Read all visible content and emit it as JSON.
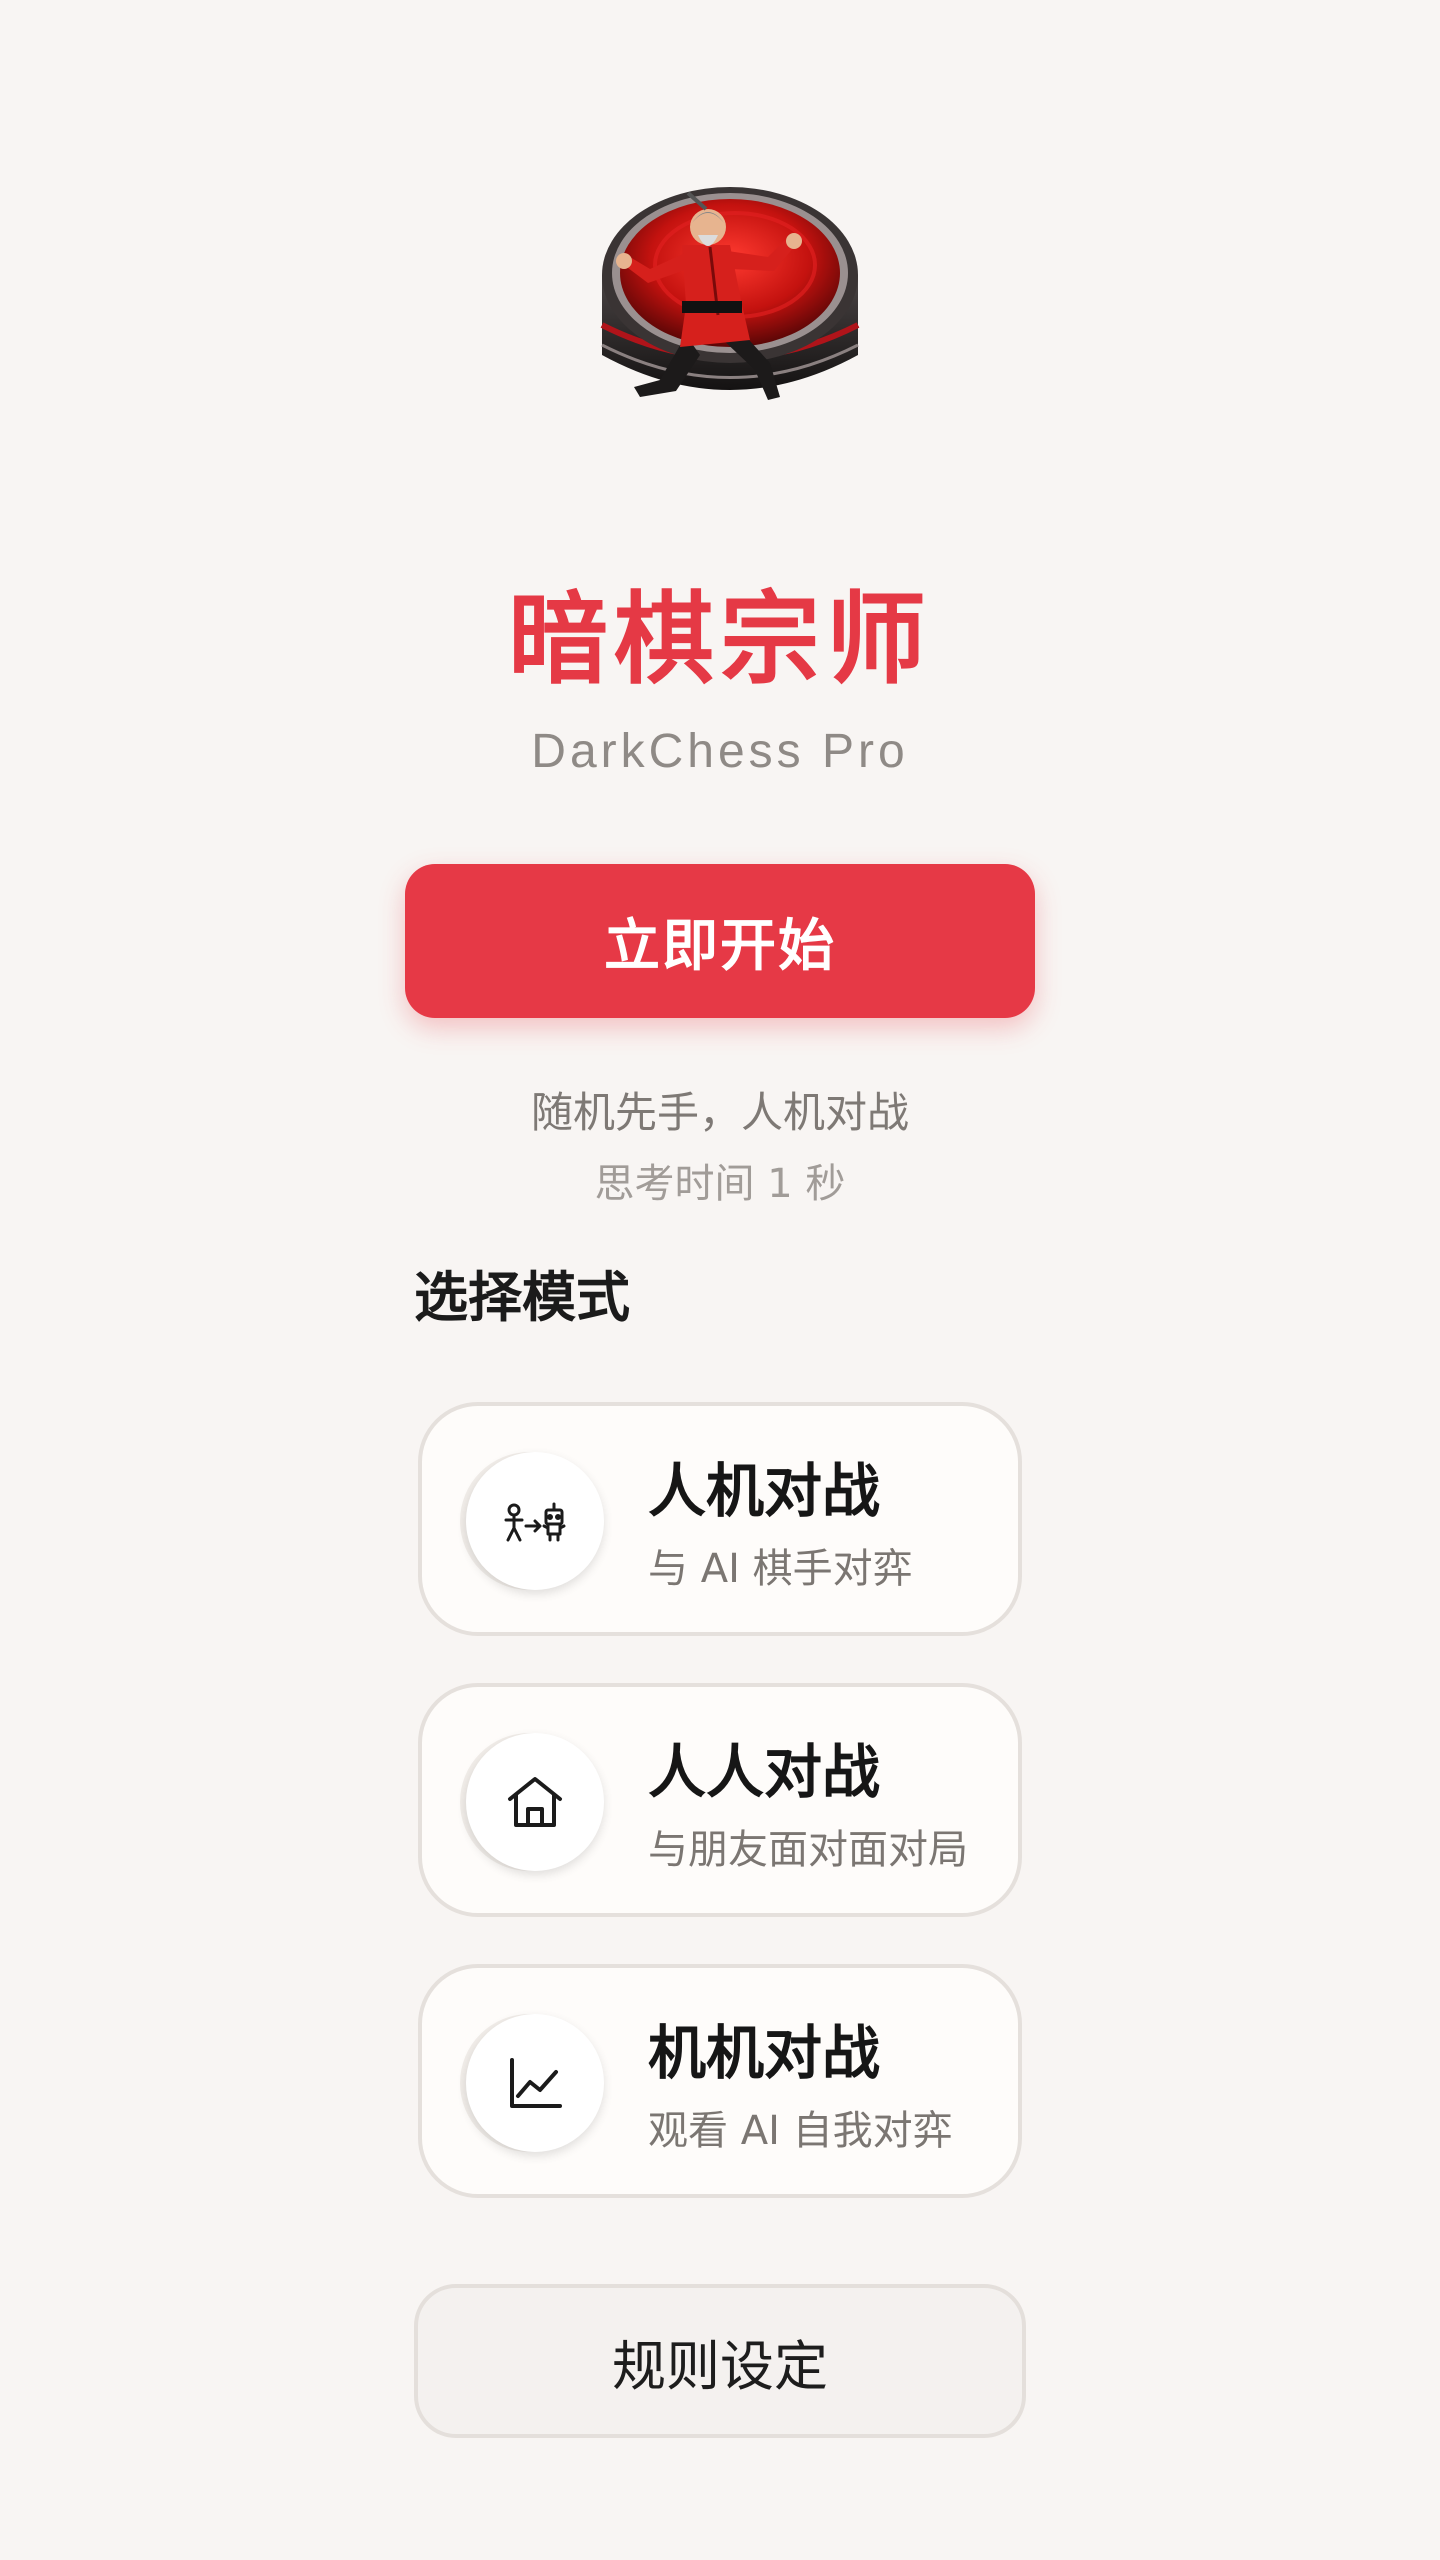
{
  "app": {
    "title": "暗棋宗师",
    "subtitle": "DarkChess Pro",
    "logo_icon": "kungfu-master-on-chess-piece"
  },
  "start": {
    "label": "立即开始",
    "hint_line1": "随机先手，人机对战",
    "hint_line2": "思考时间 1 秒"
  },
  "modes": {
    "section_title": "选择模式",
    "items": [
      {
        "title": "人机对战",
        "desc": "与 AI 棋手对弈",
        "icon": "person-vs-robot-icon"
      },
      {
        "title": "人人对战",
        "desc": "与朋友面对面对局",
        "icon": "home-icon"
      },
      {
        "title": "机机对战",
        "desc": "观看 AI 自我对弈",
        "icon": "line-chart-icon"
      }
    ]
  },
  "rules": {
    "label": "规则设定"
  },
  "colors": {
    "background": "#f8f5f3",
    "accent": "#e63946",
    "card_border": "#e5e0dc"
  }
}
